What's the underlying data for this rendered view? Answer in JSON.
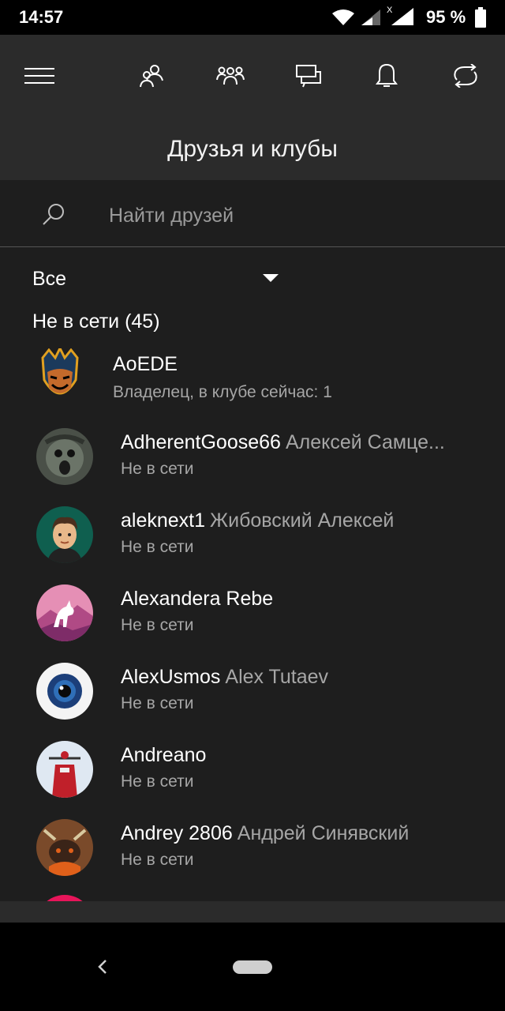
{
  "status_bar": {
    "time": "14:57",
    "battery": "95 %"
  },
  "header": {
    "title": "Друзья и клубы",
    "nav_icons": [
      "menu-icon",
      "friends-icon",
      "clubs-icon",
      "messages-icon",
      "notifications-icon",
      "refresh-icon"
    ]
  },
  "search": {
    "placeholder": "Найти друзей"
  },
  "filter": {
    "selected": "Все"
  },
  "section": {
    "title": "Не в сети (45)"
  },
  "club": {
    "name": "AoEDE",
    "subtitle": "Владелец, в клубе сейчас: 1"
  },
  "friends": [
    {
      "gamertag": "AdherentGoose66",
      "real_name": "Алексей Самце...",
      "status": "Не в сети"
    },
    {
      "gamertag": "aleknext1",
      "real_name": "Жибовский Алексей",
      "status": "Не в сети"
    },
    {
      "gamertag": "Alexandera Rebe",
      "real_name": "",
      "status": "Не в сети"
    },
    {
      "gamertag": "AlexUsmos",
      "real_name": "Alex Tutaev",
      "status": "Не в сети"
    },
    {
      "gamertag": "Andreano",
      "real_name": "",
      "status": "Не в сети"
    },
    {
      "gamertag": "Andrey 2806",
      "real_name": "Андрей Синявский",
      "status": "Не в сети"
    }
  ],
  "colors": {
    "header_bg": "#2b2b2b",
    "content_bg": "#1e1e1e",
    "secondary_text": "#a6a6a6"
  }
}
